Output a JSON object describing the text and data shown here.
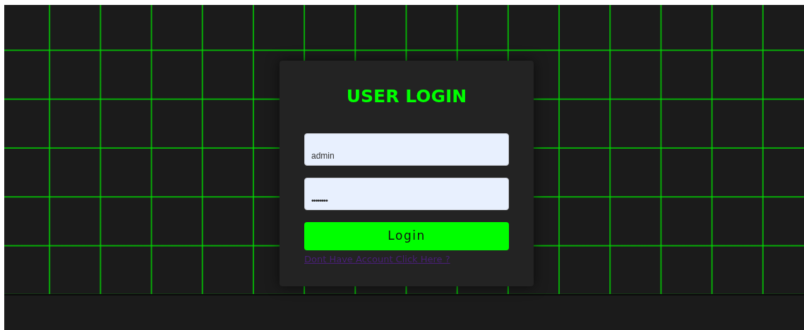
{
  "login_form": {
    "title": "USER LOGIN",
    "fields": [
      {
        "kind": "text",
        "value": "admin"
      },
      {
        "kind": "password",
        "value": "••••••••"
      }
    ],
    "submit_button": "Login",
    "signup_link": "Dont Have Account Click Here ?"
  }
}
